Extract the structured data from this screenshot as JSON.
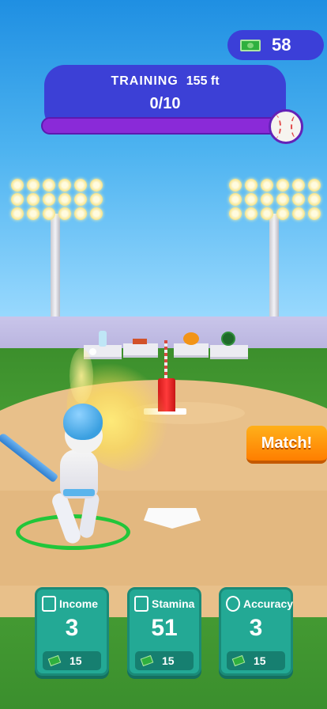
{
  "hud": {
    "money": "58",
    "money_icon": "cash-icon",
    "training_label": "TRAINING",
    "distance": "155 ft",
    "progress_text": "0/10",
    "progress_fraction": 0.0,
    "progress_icon": "baseball-icon"
  },
  "match_button": {
    "label": "Match!"
  },
  "upgrades": [
    {
      "label": "Income",
      "value": "3",
      "cost": "15",
      "icon": "income-icon"
    },
    {
      "label": "Stamina",
      "value": "51",
      "cost": "15",
      "icon": "stamina-icon"
    },
    {
      "label": "Accuracy",
      "value": "3",
      "cost": "15",
      "icon": "accuracy-icon"
    }
  ],
  "colors": {
    "hud_blue": "#3c40d6",
    "progress_purple": "#8a2ad8",
    "match_orange": "#ff8c00",
    "card_teal": "#23a995"
  }
}
